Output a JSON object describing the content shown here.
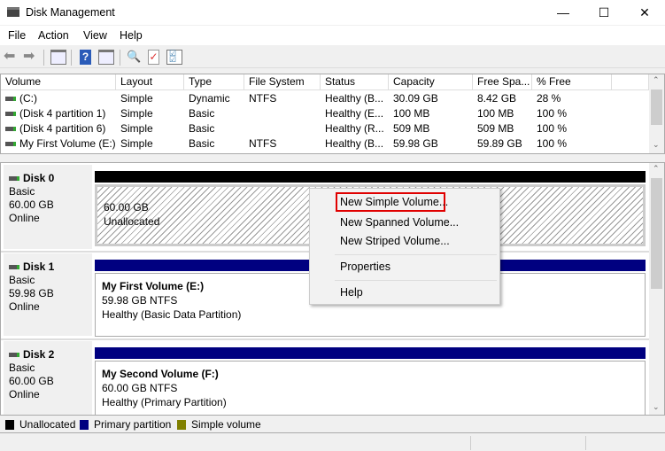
{
  "window": {
    "title": "Disk Management",
    "icon": "disk-management-icon"
  },
  "menu": [
    "File",
    "Action",
    "View",
    "Help"
  ],
  "toolbar": [
    "back-icon",
    "forward-icon",
    "show-hide-console-tree-icon",
    "help-icon",
    "show-hide-action-pane-icon",
    "connect-icon",
    "check-icon",
    "properties-list-icon"
  ],
  "volume_list": {
    "columns": [
      "Volume",
      "Layout",
      "Type",
      "File System",
      "Status",
      "Capacity",
      "Free Spa...",
      "% Free"
    ],
    "rows": [
      [
        "(C:)",
        "Simple",
        "Dynamic",
        "NTFS",
        "Healthy (B...",
        "30.09 GB",
        "8.42 GB",
        "28 %"
      ],
      [
        "(Disk 4 partition 1)",
        "Simple",
        "Basic",
        "",
        "Healthy (E...",
        "100 MB",
        "100 MB",
        "100 %"
      ],
      [
        "(Disk 4 partition 6)",
        "Simple",
        "Basic",
        "",
        "Healthy (R...",
        "509 MB",
        "509 MB",
        "100 %"
      ],
      [
        "My First Volume (E:)",
        "Simple",
        "Basic",
        "NTFS",
        "Healthy (B...",
        "59.98 GB",
        "59.89 GB",
        "100 %"
      ]
    ]
  },
  "disks": [
    {
      "name": "Disk 0",
      "type": "Basic",
      "size": "60.00 GB",
      "state": "Online",
      "volume": {
        "title": "",
        "line1": "60.00 GB",
        "line2": "Unallocated"
      },
      "bar_color": "#000000"
    },
    {
      "name": "Disk 1",
      "type": "Basic",
      "size": "59.98 GB",
      "state": "Online",
      "volume": {
        "title": "My First Volume  (E:)",
        "line1": "59.98 GB NTFS",
        "line2": "Healthy (Basic Data Partition)"
      },
      "bar_color": "#000080"
    },
    {
      "name": "Disk 2",
      "type": "Basic",
      "size": "60.00 GB",
      "state": "Online",
      "volume": {
        "title": "My Second Volume  (F:)",
        "line1": "60.00 GB NTFS",
        "line2": "Healthy (Primary Partition)"
      },
      "bar_color": "#000080"
    }
  ],
  "legend": [
    {
      "label": "Unallocated",
      "color": "#000000"
    },
    {
      "label": "Primary partition",
      "color": "#000080"
    },
    {
      "label": "Simple volume",
      "color": "#808000"
    }
  ],
  "context_menu": {
    "items": [
      "New Simple Volume...",
      "New Spanned Volume...",
      "New Striped Volume...",
      "Properties",
      "Help"
    ],
    "highlighted": "New Simple Volume...",
    "highlight_color": "#e00000"
  }
}
